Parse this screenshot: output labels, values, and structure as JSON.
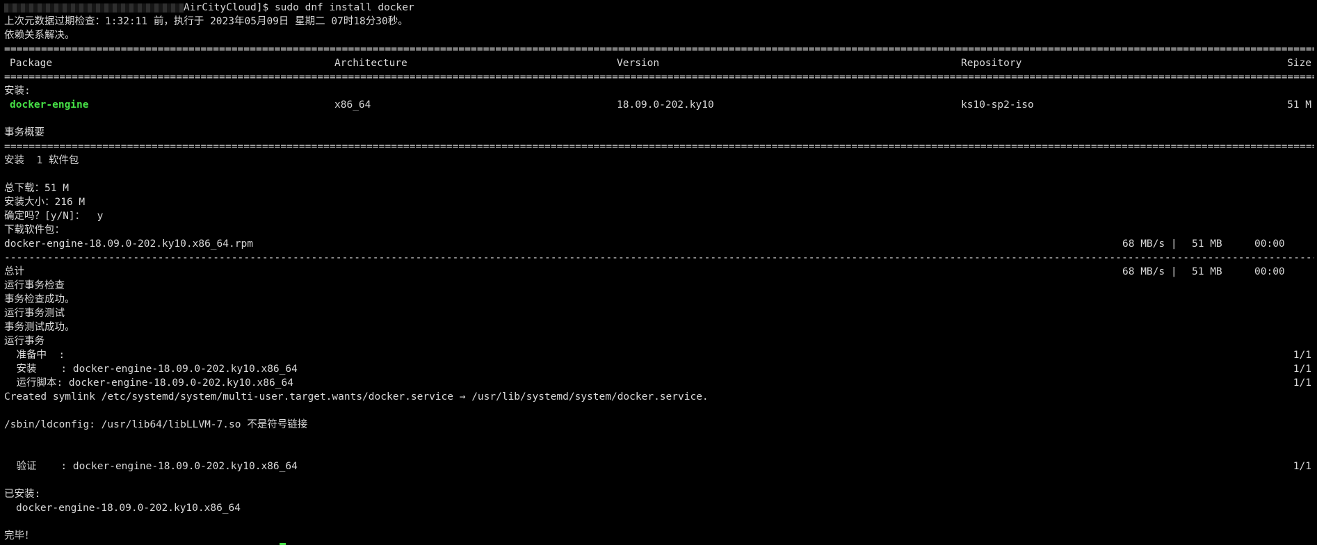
{
  "prompt": {
    "host_suffix": "AirCityCloud]$",
    "command": "sudo dnf install docker"
  },
  "lines": {
    "metadata_check": "上次元数据过期检查：1:32:11 前，执行于 2023年05月09日 星期二 07时18分30秒。",
    "deps_resolved": "依赖关系解决。",
    "install_header": "安装:",
    "summary_header": "事务概要",
    "install_count": "安装  1 软件包",
    "total_download": "总下载：51 M",
    "install_size": "安装大小：216 M",
    "confirm": "确定吗？[y/N]：  y",
    "downloading": "下载软件包：",
    "total": "总计",
    "run_check": "运行事务检查",
    "check_ok": "事务检查成功。",
    "run_test": "运行事务测试",
    "test_ok": "事务测试成功。",
    "run_transaction": "运行事务",
    "symlink": "Created symlink /etc/systemd/system/multi-user.target.wants/docker.service → /usr/lib/systemd/system/docker.service.",
    "ldconfig": "/sbin/ldconfig: /usr/lib64/libLLVM-7.so 不是符号链接",
    "installed_header": "已安装:",
    "installed_pkg": "docker-engine-18.09.0-202.ky10.x86_64",
    "done": "完毕！"
  },
  "table": {
    "headers": {
      "package": "Package",
      "architecture": "Architecture",
      "version": "Version",
      "repository": "Repository",
      "size": "Size"
    },
    "row": {
      "package": "docker-engine",
      "architecture": "x86_64",
      "version": "18.09.0-202.ky10",
      "repository": "ks10-sp2-iso",
      "size": "51 M"
    }
  },
  "download": {
    "file": "docker-engine-18.09.0-202.ky10.x86_64.rpm",
    "speed": "68 MB/s |",
    "size": "51 MB",
    "time": "00:00"
  },
  "total_stats": {
    "speed": "68 MB/s |",
    "size": "51 MB",
    "time": "00:00"
  },
  "steps": [
    {
      "label": "  准备中  :",
      "value": "",
      "progress": "1/1"
    },
    {
      "label": "  安装    :",
      "value": " docker-engine-18.09.0-202.ky10.x86_64",
      "progress": "1/1"
    },
    {
      "label": "  运行脚本:",
      "value": " docker-engine-18.09.0-202.ky10.x86_64",
      "progress": "1/1"
    }
  ],
  "verify": {
    "label": "  验证    :",
    "value": " docker-engine-18.09.0-202.ky10.x86_64",
    "progress": "1/1"
  },
  "colors": {
    "background": "#000000",
    "foreground": "#d8d8d8",
    "package_highlight": "#46e046",
    "cursor": "#46e046"
  }
}
